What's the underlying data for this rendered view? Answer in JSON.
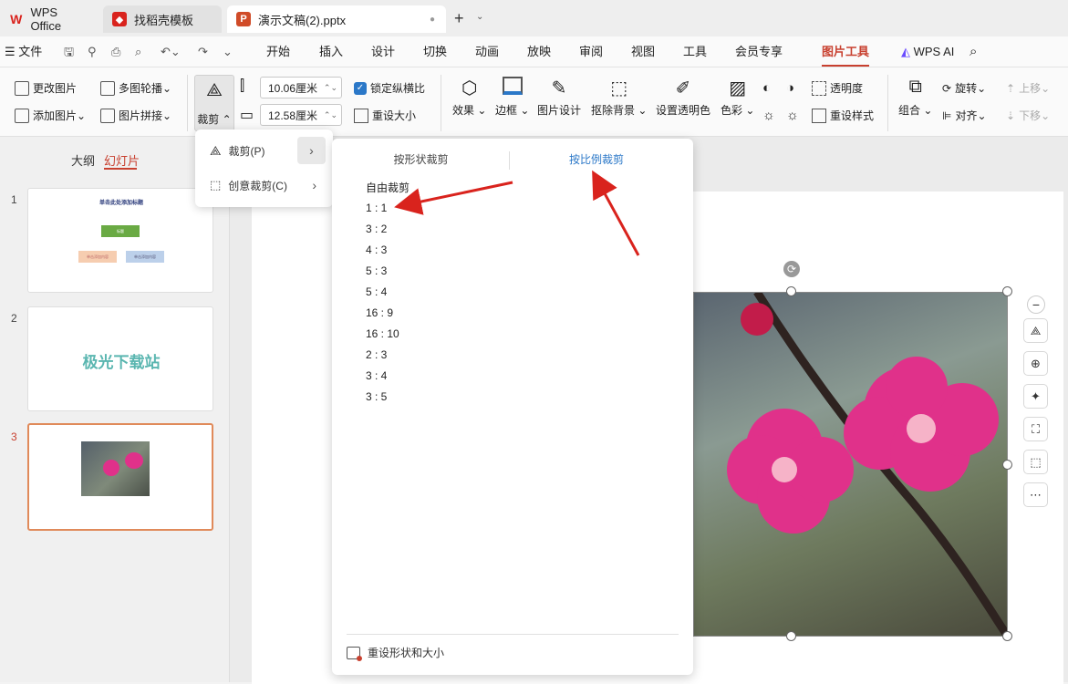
{
  "tabs": [
    {
      "label": "WPS Office",
      "icon": "wps-logo-icon"
    },
    {
      "label": "找稻壳模板",
      "icon": "docer-icon"
    },
    {
      "label": "演示文稿(2).pptx",
      "icon": "ppt-file-icon"
    }
  ],
  "menu": {
    "file": "文件",
    "items": [
      "开始",
      "插入",
      "设计",
      "切换",
      "动画",
      "放映",
      "审阅",
      "视图",
      "工具",
      "会员专享",
      "图片工具"
    ],
    "active": "图片工具",
    "wps_ai": "WPS AI"
  },
  "ribbon": {
    "change_pic": "更改图片",
    "add_pic": "添加图片",
    "multi_carousel": "多图轮播",
    "pic_stitch": "图片拼接",
    "crop": "裁剪",
    "width": "10.06厘米",
    "height": "12.58厘米",
    "lock_ratio": "锁定纵横比",
    "reset_size": "重设大小",
    "effects": "效果",
    "border": "边框",
    "pic_design": "图片设计",
    "remove_bg": "抠除背景",
    "set_transparent": "设置透明色",
    "color": "色彩",
    "transparency": "透明度",
    "reset_style": "重设样式",
    "group": "组合",
    "rotate": "旋转",
    "align": "对齐",
    "up": "上移",
    "down": "下移"
  },
  "left_panel": {
    "outline_tab": "大纲",
    "slides_tab": "幻灯片",
    "slides": [
      {
        "num": "1",
        "title": "单击此处添加标题",
        "box_top": "标题",
        "box_left": "单击添加内容",
        "box_right": "单击添加内容"
      },
      {
        "num": "2",
        "text": "极光下载站"
      },
      {
        "num": "3"
      }
    ]
  },
  "crop_menu": {
    "crop_item": "裁剪(P)",
    "creative_crop": "创意裁剪(C)"
  },
  "crop_submenu": {
    "tab_shape": "按形状裁剪",
    "tab_ratio": "按比例裁剪",
    "free_crop": "自由裁剪",
    "ratios": [
      "1 : 1",
      "3 : 2",
      "4 : 3",
      "5 : 3",
      "5 : 4",
      "16 : 9",
      "16 : 10",
      "2 : 3",
      "3 : 4",
      "3 : 5"
    ],
    "reset": "重设形状和大小"
  },
  "colors": {
    "accent": "#c8402f",
    "link": "#2b78c8",
    "arrow": "#d9231d",
    "flower": "#e0318a"
  }
}
